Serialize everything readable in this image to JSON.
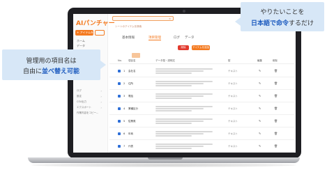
{
  "app": {
    "logo": "AIパンチャー",
    "new_button": "+ アイテムを追加",
    "search_placeholder": "シートのアイテムを検索",
    "search_clear": "×"
  },
  "sidebar": {
    "links": [
      "ホーム",
      "データ"
    ],
    "items": [
      "ログ",
      "設定",
      "CSV出力",
      "エクスポート",
      "作業内容をコピー..."
    ]
  },
  "tabs": [
    {
      "label": "基本情報",
      "active": false
    },
    {
      "label": "項目管理",
      "active": true
    },
    {
      "label": "ログ",
      "active": false
    },
    {
      "label": "データ",
      "active": false
    }
  ],
  "toolbar": {
    "delete_label": "削除",
    "add_label": "アイテムを追加"
  },
  "table": {
    "headers": [
      "No.",
      "項目名",
      "データ型・説明文",
      "型",
      "編集",
      "削除"
    ],
    "rows": [
      {
        "num": "1",
        "name": "会社名",
        "type": "テキスト",
        "edit": "✎",
        "del": "🗑"
      },
      {
        "num": "2",
        "name": "住所",
        "type": "テキスト",
        "edit": "✎",
        "del": "🗑"
      },
      {
        "num": "3",
        "name": "電話",
        "type": "テキスト",
        "edit": "✎",
        "del": "🗑"
      },
      {
        "num": "4",
        "name": "業種区分",
        "type": "テキスト",
        "edit": "✎",
        "del": "🗑"
      },
      {
        "num": "5",
        "name": "従業員",
        "type": "テキスト",
        "edit": "✎",
        "del": "🗑"
      },
      {
        "num": "6",
        "name": "年商",
        "type": "テキスト",
        "edit": "✎",
        "del": "🗑"
      },
      {
        "num": "7",
        "name": "代表",
        "type": "テキスト",
        "edit": "✎",
        "del": "🗑"
      }
    ]
  },
  "callouts": {
    "left": {
      "line1": "管理用の項目名は",
      "line2_prefix": "自由に",
      "line2_highlight": "並べ替え可能"
    },
    "right": {
      "line1": "やりたいことを",
      "line2_highlight": "日本語で命令",
      "line2_suffix": "するだけ"
    }
  },
  "colors": {
    "accent": "#f47a20",
    "danger": "#e23a2e",
    "checkbox": "#2e6fd8",
    "callout_bg": "#d7e7f7",
    "highlight_text": "#1d5bbf"
  }
}
